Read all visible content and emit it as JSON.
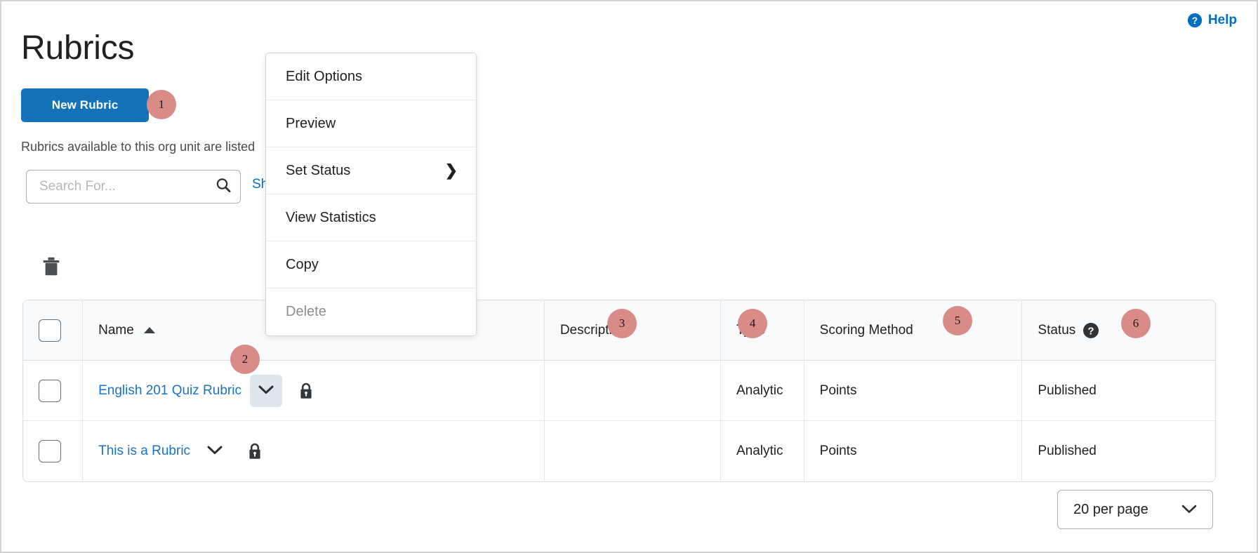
{
  "header": {
    "title": "Rubrics",
    "help_label": "Help",
    "help_icon": "help-circle-icon"
  },
  "toolbar": {
    "new_rubric_label": "New Rubric",
    "intro_text": "Rubrics available to this org unit are listed",
    "delete_icon": "trash-icon"
  },
  "search": {
    "value": "",
    "placeholder": "Search For...",
    "icon": "search-icon",
    "show_options_label": "Show Search Options"
  },
  "context_menu": {
    "items": [
      {
        "label": "Edit Options",
        "disabled": false,
        "submenu": false
      },
      {
        "label": "Preview",
        "disabled": false,
        "submenu": false
      },
      {
        "label": "Set Status",
        "disabled": false,
        "submenu": true
      },
      {
        "label": "View Statistics",
        "disabled": false,
        "submenu": false
      },
      {
        "label": "Copy",
        "disabled": false,
        "submenu": false
      },
      {
        "label": "Delete",
        "disabled": true,
        "submenu": false
      }
    ],
    "submenu_caret": "❯"
  },
  "table": {
    "columns": [
      {
        "key": "check",
        "label": ""
      },
      {
        "key": "name",
        "label": "Name"
      },
      {
        "key": "description",
        "label": "Description"
      },
      {
        "key": "type",
        "label": "Type"
      },
      {
        "key": "scoring_method",
        "label": "Scoring Method"
      },
      {
        "key": "status",
        "label": "Status"
      }
    ],
    "sort_column": "Name",
    "sort_direction": "ascending",
    "status_help_icon": "help-circle-icon",
    "rows": [
      {
        "name": "English 201 Quiz Rubric",
        "description": "",
        "type": "Analytic",
        "scoring_method": "Points",
        "status": "Published",
        "locked": true,
        "menu_open": true
      },
      {
        "name": "This is a Rubric",
        "description": "",
        "type": "Analytic",
        "scoring_method": "Points",
        "status": "Published",
        "locked": true,
        "menu_open": false
      }
    ]
  },
  "pagination": {
    "per_page_label": "20 per page"
  },
  "callouts": [
    {
      "number": "1"
    },
    {
      "number": "2"
    },
    {
      "number": "3"
    },
    {
      "number": "4"
    },
    {
      "number": "5"
    },
    {
      "number": "6"
    }
  ],
  "colors": {
    "primary_blue": "#1473b8",
    "link_blue": "#1a73c1",
    "help_blue": "#006fbf",
    "callout_rose": "#d98c87",
    "header_bg": "#f9fafb",
    "border": "#d9dde1",
    "text": "#202122",
    "muted_text": "#8b8f92"
  }
}
